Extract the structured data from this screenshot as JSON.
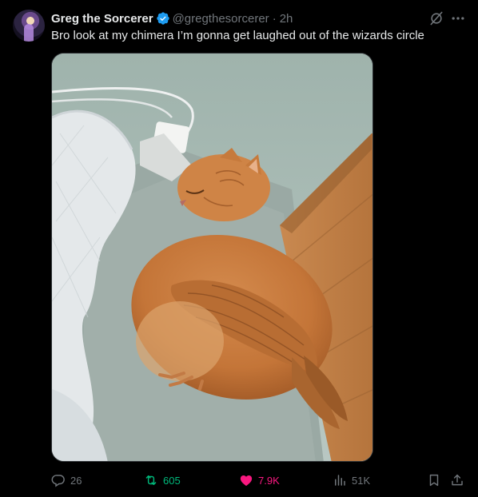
{
  "tweet": {
    "author": {
      "display_name": "Greg the Sorcerer",
      "handle": "@gregthesorcerer",
      "verified": true
    },
    "separator": "·",
    "time": "2h",
    "text": "Bro look at my chimera I’m gonna get laughed out of the wizards circle",
    "media": {
      "kind": "photo"
    },
    "actions": {
      "replies": "26",
      "retweets": "605",
      "likes": "7.9K",
      "views": "51K"
    }
  },
  "colors": {
    "background": "#000000",
    "text_primary": "#e7e9ea",
    "text_secondary": "#71767b",
    "verified_blue": "#1d9bf0",
    "retweet_green": "#00ba7c",
    "like_pink": "#f91880"
  },
  "icons": {
    "verified": "verified-badge-icon",
    "grok": "grok-icon",
    "more": "more-dots-icon",
    "reply": "reply-icon",
    "retweet": "retweet-icon",
    "like": "heart-icon",
    "views": "views-chart-icon",
    "bookmark": "bookmark-icon",
    "share": "share-icon"
  }
}
